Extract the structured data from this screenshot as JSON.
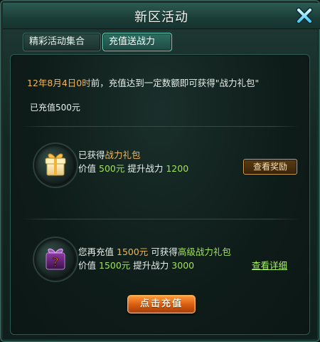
{
  "window": {
    "title": "新区活动"
  },
  "tabs": [
    {
      "label": "精彩活动集合",
      "active": false
    },
    {
      "label": "充值送战力",
      "active": true
    }
  ],
  "content": {
    "deadline": "12年8月4日0时",
    "description_rest": "前，充值达到一定数额即可获得\"战力礼包\"",
    "charged_text": "已充值500元",
    "reward1": {
      "status_prefix": "已获得",
      "gift_name": "战力礼包",
      "value_label": "价值",
      "value_amount": "500元",
      "power_label": "提升战力",
      "power_amount": "1200",
      "button_label": "查看奖励"
    },
    "reward2": {
      "prefix": "您再充值",
      "amount_needed": "1500元",
      "middle": "可获得",
      "gift_name": "高级战力礼包",
      "value_label": "价值",
      "value_amount": "1500元",
      "power_label": "提升战力",
      "power_amount": "3000",
      "link_label": "查看详细"
    },
    "recharge_button_label": "点击充值"
  },
  "icons": {
    "close": "close-x-icon",
    "gift_received": "gift-box-icon",
    "gift_locked": "question-gift-icon"
  },
  "colors": {
    "deadline": "#f4b55b",
    "highlight_orange": "#f0b653",
    "highlight_green": "#9fe25a",
    "accent_teal": "#67d9c0"
  }
}
